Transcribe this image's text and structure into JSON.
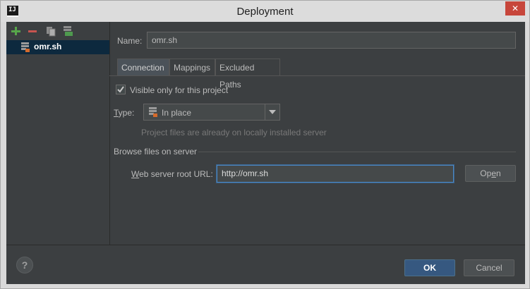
{
  "window": {
    "title": "Deployment",
    "app_icon_text": "IJ"
  },
  "toolbar": {
    "add": "add-icon",
    "remove": "remove-icon",
    "copy": "copy-icon",
    "default": "default-server-icon"
  },
  "tree": {
    "items": [
      {
        "label": "omr.sh",
        "icon": "server-icon",
        "selected": true
      }
    ]
  },
  "form": {
    "name_label": "Name:",
    "name_value": "omr.sh",
    "tabs": [
      {
        "label": "Connection",
        "active": true
      },
      {
        "label": "Mappings",
        "active": false
      },
      {
        "label": "Excluded Paths",
        "active": false
      }
    ],
    "visible_checkbox_label": "Visible only for this project",
    "visible_checked": true,
    "type_label": "Type:",
    "type_value": "In place",
    "type_hint": "Project files are already on locally installed server",
    "browse_section": "Browse files on server",
    "web_root_label": "Web server root URL:",
    "web_root_value": "http://omr.sh",
    "open_button": "Open"
  },
  "footer": {
    "ok": "OK",
    "cancel": "Cancel",
    "help": "?"
  },
  "colors": {
    "accent": "#365880",
    "selection": "#0d293e",
    "background": "#3c3f41",
    "close": "#c7463b"
  }
}
